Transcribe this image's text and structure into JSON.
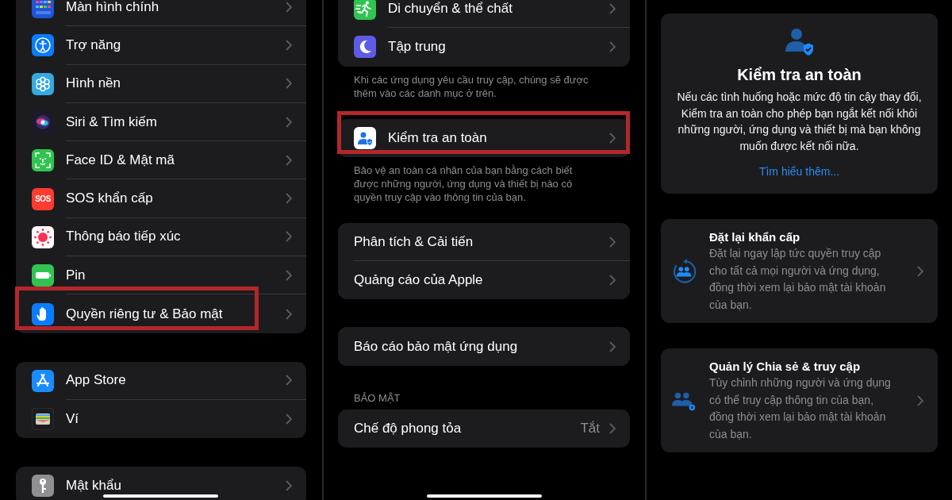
{
  "settings": {
    "groups": [
      {
        "rows": [
          {
            "label": "Màn hình chính",
            "highlighted": false
          },
          {
            "label": "Trợ năng",
            "highlighted": false
          },
          {
            "label": "Hình nền",
            "highlighted": false
          },
          {
            "label": "Siri & Tìm kiếm",
            "highlighted": false
          },
          {
            "label": "Face ID & Mật mã",
            "highlighted": false
          },
          {
            "label": "SOS khẩn cấp",
            "icon_text": "SOS",
            "highlighted": false
          },
          {
            "label": "Thông báo tiếp xúc",
            "highlighted": false
          },
          {
            "label": "Pin",
            "highlighted": false
          },
          {
            "label": "Quyền riêng tư & Bảo mật",
            "highlighted": true
          }
        ]
      },
      {
        "rows": [
          {
            "label": "App Store",
            "highlighted": false
          },
          {
            "label": "Ví",
            "highlighted": false
          }
        ]
      },
      {
        "rows": [
          {
            "label": "Mật khẩu",
            "highlighted": false
          }
        ]
      }
    ]
  },
  "privacy": {
    "sections": [
      {
        "rows": [
          {
            "kind": "icon",
            "label": "Di chuyển & thể chất",
            "highlighted": false
          },
          {
            "kind": "icon",
            "label": "Tập trung",
            "highlighted": false
          }
        ],
        "footer": "Khi các ứng dụng yêu cầu truy cập, chúng sẽ được thêm vào các danh mục ở trên."
      },
      {
        "rows": [
          {
            "kind": "icon",
            "label": "Kiểm tra an toàn",
            "highlighted": true
          }
        ],
        "footer": "Bảo vệ an toàn cá nhân của bạn bằng cách biết được những người, ứng dụng và thiết bị nào có quyền truy cập vào thông tin của bạn."
      },
      {
        "rows": [
          {
            "kind": "plain",
            "label": "Phân tích & Cải tiến",
            "highlighted": false
          },
          {
            "kind": "plain",
            "label": "Quảng cáo của Apple",
            "highlighted": false
          }
        ]
      },
      {
        "rows": [
          {
            "kind": "plain",
            "label": "Báo cáo bảo mật ứng dụng",
            "highlighted": false
          }
        ]
      },
      {
        "header": "BẢO MẬT",
        "rows": [
          {
            "kind": "plain",
            "label": "Chế độ phong tỏa",
            "value": "Tắt",
            "highlighted": false
          }
        ]
      }
    ]
  },
  "safety_check": {
    "title": "Kiểm tra an toàn",
    "description": "Nếu các tình huống hoặc mức độ tin cậy thay đổi, Kiểm tra an toàn cho phép bạn ngắt kết nối khỏi những người, ứng dụng và thiết bị mà bạn không muốn được kết nối nữa.",
    "link": "Tìm hiểu thêm...",
    "options": [
      {
        "title": "Đặt lại khẩn cấp",
        "description": "Đặt lại ngay lập tức quyền truy cập cho tất cả mọi người và ứng dụng, đồng thời xem lại bảo mật tài khoản của bạn."
      },
      {
        "title": "Quản lý Chia sẻ & truy cập",
        "description": "Tùy chỉnh những người và ứng dụng có thể truy cập thông tin của bạn, đồng thời xem lại bảo mật tài khoản của bạn."
      }
    ]
  }
}
